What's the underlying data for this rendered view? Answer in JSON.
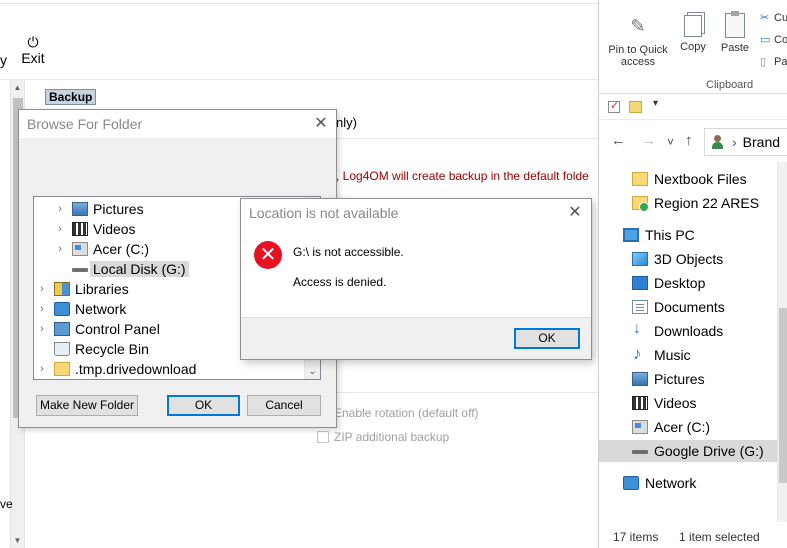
{
  "background_app": {
    "left_button_partial": "y",
    "exit_label": "Exit",
    "exit_icon": "power-icon",
    "section_title": "Backup",
    "only_text_partial": "nly)",
    "warning_text": ", Log4OM will create backup in the default folde",
    "enable_rotation": "Enable rotation (default off)",
    "zip_backup": "ZIP additional backup",
    "left_partial_text": "ve"
  },
  "browse_dialog": {
    "title": "Browse For Folder",
    "tree": [
      {
        "label": "Pictures",
        "icon": "pictures-icon",
        "expander": "›",
        "level": 2
      },
      {
        "label": "Videos",
        "icon": "videos-icon",
        "expander": "›",
        "level": 2
      },
      {
        "label": "Acer (C:)",
        "icon": "drive-c-icon",
        "expander": "›",
        "level": 2
      },
      {
        "label": "Local Disk (G:)",
        "icon": "drive-g-icon",
        "expander": "",
        "level": 2,
        "selected": true
      },
      {
        "label": "Libraries",
        "icon": "libraries-icon",
        "expander": "›",
        "level": 1
      },
      {
        "label": "Network",
        "icon": "network-icon",
        "expander": "›",
        "level": 1
      },
      {
        "label": "Control Panel",
        "icon": "control-panel-icon",
        "expander": "›",
        "level": 1
      },
      {
        "label": "Recycle Bin",
        "icon": "recycle-bin-icon",
        "expander": "",
        "level": 1
      },
      {
        "label": ".tmp.drivedownload",
        "icon": "folder-icon",
        "expander": "›",
        "level": 1
      }
    ],
    "make_new_folder": "Make New Folder",
    "ok": "OK",
    "cancel": "Cancel"
  },
  "error_dialog": {
    "title": "Location is not available",
    "message_line1": "G:\\ is not accessible.",
    "message_line2": "Access is denied.",
    "ok": "OK",
    "icon": "error-icon"
  },
  "explorer": {
    "ribbon": {
      "pin_label": "Pin to Quick access",
      "copy_label": "Copy",
      "paste_label": "Paste",
      "cut_partial": "Cu",
      "copy_path_partial": "Co",
      "paste_shortcut_partial": "Pa",
      "group_label": "Clipboard"
    },
    "address": {
      "back": "←",
      "forward": "→",
      "recent": "˅",
      "up": "↑",
      "crumb_sep": "›",
      "crumb": "Brand"
    },
    "nav": [
      {
        "label": "Nextbook Files",
        "icon": "folder-icon"
      },
      {
        "label": "Region 22 ARES",
        "icon": "shared-folder-icon"
      },
      {
        "label": "This PC",
        "icon": "this-pc-icon"
      },
      {
        "label": "3D Objects",
        "icon": "3d-objects-icon"
      },
      {
        "label": "Desktop",
        "icon": "desktop-icon"
      },
      {
        "label": "Documents",
        "icon": "documents-icon"
      },
      {
        "label": "Downloads",
        "icon": "downloads-icon"
      },
      {
        "label": "Music",
        "icon": "music-icon"
      },
      {
        "label": "Pictures",
        "icon": "pictures-icon"
      },
      {
        "label": "Videos",
        "icon": "videos-icon"
      },
      {
        "label": "Acer (C:)",
        "icon": "drive-c-icon"
      },
      {
        "label": "Google Drive (G:)",
        "icon": "drive-g-icon",
        "selected": true
      },
      {
        "label": "Network",
        "icon": "network-icon"
      }
    ],
    "status": {
      "items": "17 items",
      "selected": "1 item selected"
    }
  },
  "colors": {
    "error_red": "#e81123",
    "warning_text": "#a00000",
    "selection_grey": "#d9d9d9",
    "accent_blue": "#0078d7"
  }
}
